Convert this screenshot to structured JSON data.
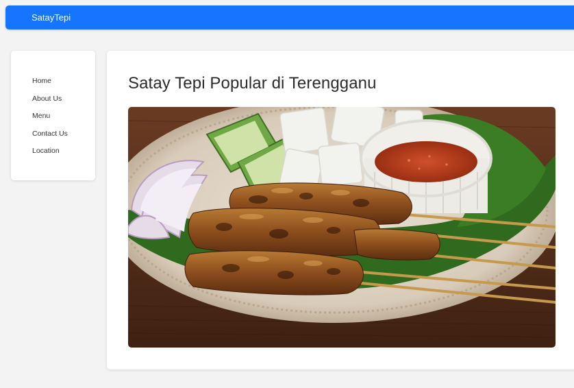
{
  "navbar": {
    "brand": "SatayTepi",
    "color": "#1674ff"
  },
  "sidebar": {
    "items": [
      {
        "label": "Home"
      },
      {
        "label": "About Us"
      },
      {
        "label": "Menu"
      },
      {
        "label": "Contact Us"
      },
      {
        "label": "Location"
      }
    ]
  },
  "main": {
    "title": "Satay Tepi Popular di Terengganu",
    "image_subject": "satay-skewers-photo"
  }
}
